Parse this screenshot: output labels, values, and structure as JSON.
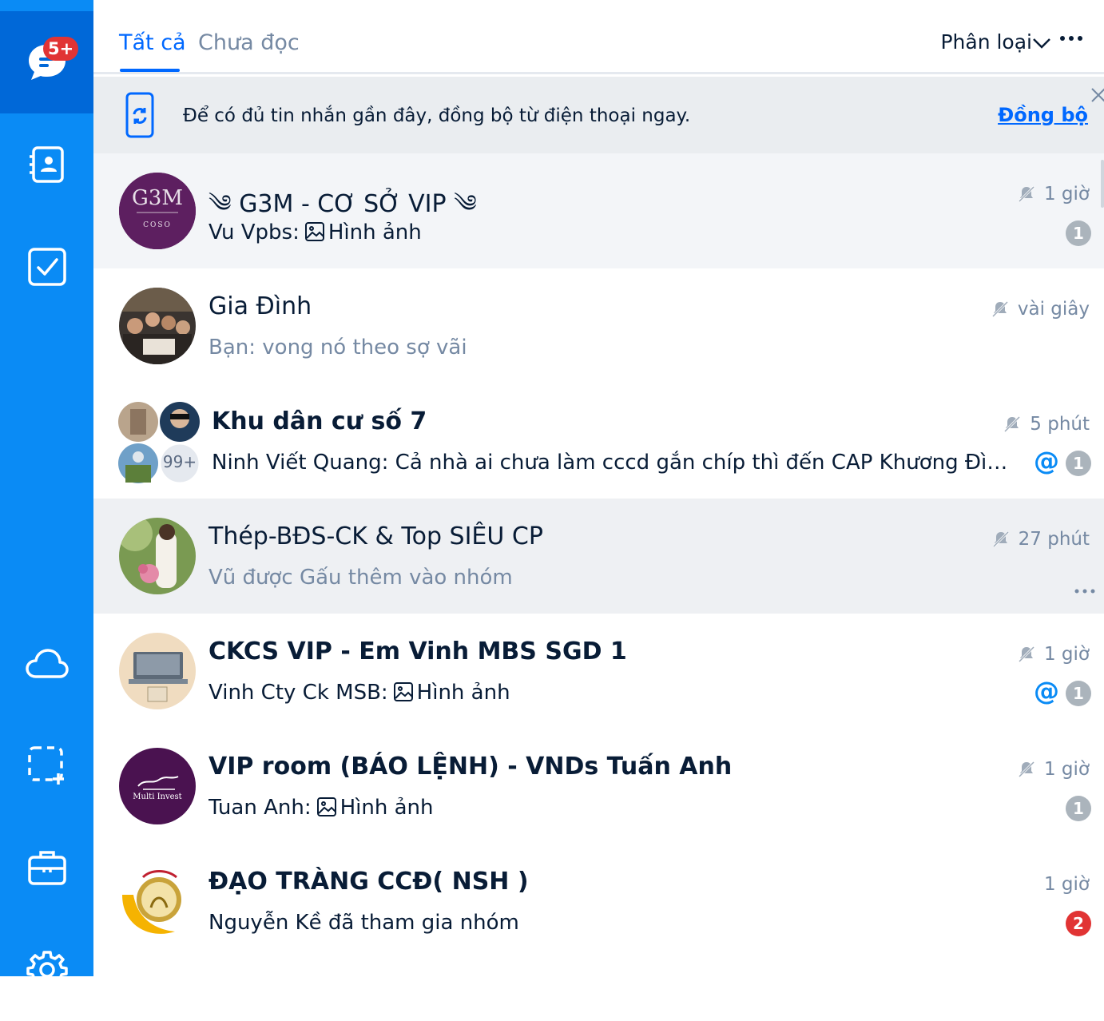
{
  "rail": {
    "messages_badge": "5+"
  },
  "tabs": [
    {
      "label": "Tất cả"
    },
    {
      "label": "Chưa đọc"
    }
  ],
  "classify": {
    "label": "Phân loại"
  },
  "banner": {
    "text": "Để có đủ tin nhắn gần đây, đồng bộ từ điện thoại ngay.",
    "link": "Đồng bộ"
  },
  "conversations": [
    {
      "title": "G3M - CƠ SỞ VIP",
      "sender": "Vu Vpbs:",
      "preview": "Hình ảnh",
      "time": "1 giờ",
      "unread": "1"
    },
    {
      "title": "Gia Đình",
      "preview": "Bạn: vong nó theo sợ vãi",
      "time": "vài giây"
    },
    {
      "title": "Khu dân cư số 7",
      "preview": "Ninh Viết Quang: Cả nhà ai chưa làm cccd gắn chíp thì đến CAP Khương Đình l...",
      "time": "5 phút",
      "mention": "@",
      "unread": "1",
      "member_more": "99+"
    },
    {
      "title": "Thép-BĐS-CK & Top SIÊU CP",
      "preview": "Vũ được Gấu thêm vào nhóm",
      "time": "27 phút"
    },
    {
      "title": "CKCS VIP - Em Vinh MBS SGD 1",
      "sender": "Vinh Cty Ck MSB:",
      "preview": "Hình ảnh",
      "time": "1 giờ",
      "mention": "@",
      "unread": "1"
    },
    {
      "title": "VIP room (BÁO LỆNH) - VNDs Tuấn Anh",
      "sender": "Tuan Anh:",
      "preview": "Hình ảnh",
      "time": "1 giờ",
      "unread": "1",
      "avatar_text": "Multi Invest"
    },
    {
      "title": "ĐẠO TRÀNG CCĐ( NSH )",
      "preview": "Nguyễn Kề đã tham gia nhóm",
      "time": "1 giờ",
      "unread": "2"
    }
  ],
  "colors": {
    "rail": "#0a8bf5",
    "rail_active": "#0068d8",
    "accent": "#0068ff",
    "badge_red": "#e13434",
    "muted": "#7589a3"
  }
}
